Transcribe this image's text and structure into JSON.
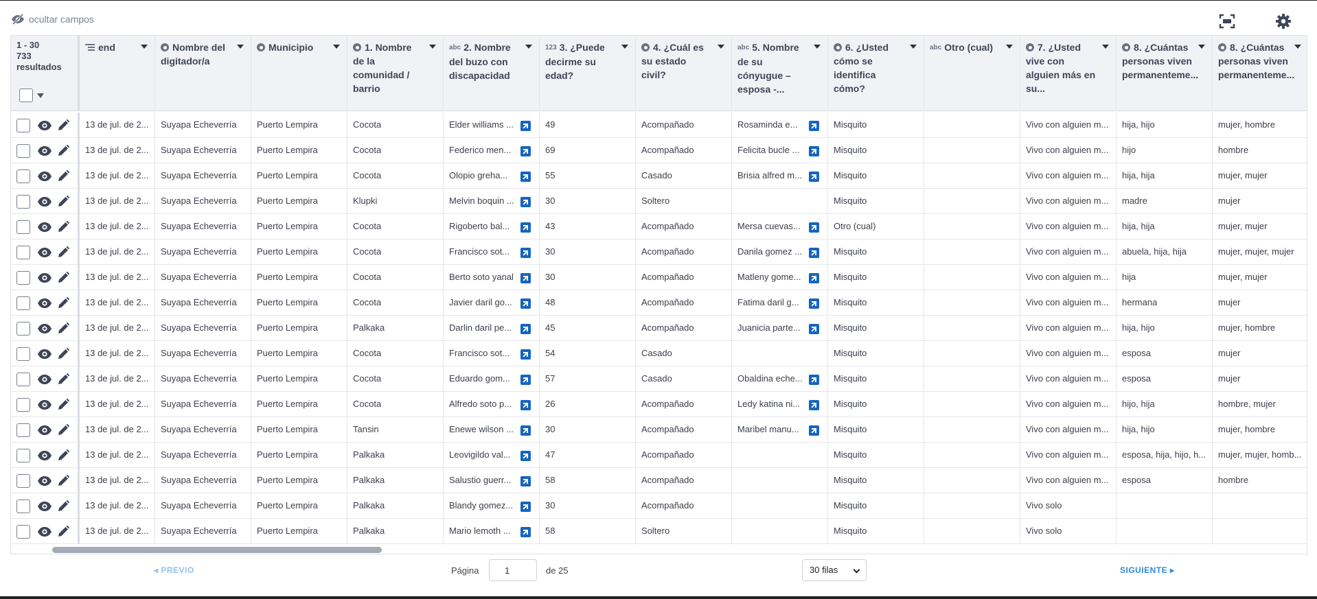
{
  "toolbar": {
    "hide_fields_label": "ocultar campos",
    "hide_fields_icon": "eye-slash-icon",
    "fullscreen_icon": "fullscreen-icon",
    "settings_icon": "gear-icon"
  },
  "summary": {
    "range": "1 - 30",
    "results": "733 resultados"
  },
  "columns": [
    {
      "type": "list",
      "label": "end"
    },
    {
      "type": "select",
      "label": "Nombre del digitador/a"
    },
    {
      "type": "select",
      "label": "Municipio"
    },
    {
      "type": "select",
      "label": "1. Nombre de la comunidad / barrio"
    },
    {
      "type": "abc",
      "label": "2. Nombre del buzo con discapacidad"
    },
    {
      "type": "123",
      "label": "3. ¿Puede decirme su edad?"
    },
    {
      "type": "select",
      "label": "4. ¿Cuál es su estado civil?"
    },
    {
      "type": "abc",
      "label": "5. Nombre de su cónyugue – esposa -..."
    },
    {
      "type": "select",
      "label": "6. ¿Usted cómo se identifica cómo?"
    },
    {
      "type": "abc",
      "label": "Otro (cual)"
    },
    {
      "type": "select",
      "label": "7. ¿Usted vive con alguien más en su..."
    },
    {
      "type": "select",
      "label": "8. ¿Cuántas personas viven permanenteme..."
    },
    {
      "type": "select",
      "label": "8. ¿Cuántas personas viven permanenteme..."
    }
  ],
  "rows": [
    [
      "13 de jul. de 2...",
      "Suyapa Echeverría",
      "Puerto Lempira",
      "Cocota",
      "Elder williams ...",
      "49",
      "Acompañado",
      "Rosaminda e...",
      "Misquito",
      "",
      "Vivo con alguien m...",
      "hija, hijo",
      "mujer, hombre"
    ],
    [
      "13 de jul. de 2...",
      "Suyapa Echeverría",
      "Puerto Lempira",
      "Cocota",
      "Federico men...",
      "69",
      "Acompañado",
      "Felicita bucle ...",
      "Misquito",
      "",
      "Vivo con alguien m...",
      "hijo",
      "hombre"
    ],
    [
      "13 de jul. de 2...",
      "Suyapa Echeverría",
      "Puerto Lempira",
      "Cocota",
      "Olopio greha...",
      "55",
      "Casado",
      "Brisia alfred m...",
      "Misquito",
      "",
      "Vivo con alguien m...",
      "hija, hija",
      "mujer, mujer"
    ],
    [
      "13 de jul. de 2...",
      "Suyapa Echeverría",
      "Puerto Lempira",
      "Klupki",
      "Melvin boquin ...",
      "30",
      "Soltero",
      "",
      "Misquito",
      "",
      "Vivo con alguien m...",
      "madre",
      "mujer"
    ],
    [
      "13 de jul. de 2...",
      "Suyapa Echeverría",
      "Puerto Lempira",
      "Cocota",
      "Rigoberto bal...",
      "43",
      "Acompañado",
      "Mersa cuevas...",
      "Otro (cual)",
      "",
      "Vivo con alguien m...",
      "hija, hija",
      "mujer, mujer"
    ],
    [
      "13 de jul. de 2...",
      "Suyapa Echeverría",
      "Puerto Lempira",
      "Cocota",
      "Francisco sot...",
      "30",
      "Acompañado",
      "Danila gomez ...",
      "Misquito",
      "",
      "Vivo con alguien m...",
      "abuela, hija, hija",
      "mujer, mujer, mujer"
    ],
    [
      "13 de jul. de 2...",
      "Suyapa Echeverría",
      "Puerto Lempira",
      "Cocota",
      "Berto soto yanal",
      "30",
      "Acompañado",
      "Matleny gome...",
      "Misquito",
      "",
      "Vivo con alguien m...",
      "hija",
      "mujer, mujer"
    ],
    [
      "13 de jul. de 2...",
      "Suyapa Echeverría",
      "Puerto Lempira",
      "Cocota",
      "Javier daril go...",
      "48",
      "Acompañado",
      "Fatima daril g...",
      "Misquito",
      "",
      "Vivo con alguien m...",
      "hermana",
      "mujer"
    ],
    [
      "13 de jul. de 2...",
      "Suyapa Echeverría",
      "Puerto Lempira",
      "Palkaka",
      "Darlin daril pe...",
      "45",
      "Acompañado",
      "Juanicia parte...",
      "Misquito",
      "",
      "Vivo con alguien m...",
      "hija, hijo",
      "mujer, hombre"
    ],
    [
      "13 de jul. de 2...",
      "Suyapa Echeverría",
      "Puerto Lempira",
      "Cocota",
      "Francisco sot...",
      "54",
      "Casado",
      "",
      "Misquito",
      "",
      "Vivo con alguien m...",
      "esposa",
      "mujer"
    ],
    [
      "13 de jul. de 2...",
      "Suyapa Echeverría",
      "Puerto Lempira",
      "Cocota",
      "Eduardo gom...",
      "57",
      "Casado",
      "Obaldina eche...",
      "Misquito",
      "",
      "Vivo con alguien m...",
      "esposa",
      "mujer"
    ],
    [
      "13 de jul. de 2...",
      "Suyapa Echeverría",
      "Puerto Lempira",
      "Cocota",
      "Alfredo soto p...",
      "26",
      "Acompañado",
      "Ledy katina ni...",
      "Misquito",
      "",
      "Vivo con alguien m...",
      "hijo, hija",
      "hombre, mujer"
    ],
    [
      "13 de jul. de 2...",
      "Suyapa Echeverría",
      "Puerto Lempira",
      "Tansin",
      "Enewe wilson ...",
      "30",
      "Acompañado",
      "Maribel manu...",
      "Misquito",
      "",
      "Vivo con alguien m...",
      "hija, hijo",
      "mujer, hombre"
    ],
    [
      "13 de jul. de 2...",
      "Suyapa Echeverría",
      "Puerto Lempira",
      "Palkaka",
      "Leovigildo val...",
      "47",
      "Acompañado",
      "",
      "Misquito",
      "",
      "Vivo con alguien m...",
      "esposa, hija, hijo, h...",
      "mujer, mujer, homb..."
    ],
    [
      "13 de jul. de 2...",
      "Suyapa Echeverría",
      "Puerto Lempira",
      "Palkaka",
      "Salustio guerr...",
      "58",
      "Acompañado",
      "",
      "Misquito",
      "",
      "Vivo con alguien m...",
      "esposa",
      "hombre"
    ],
    [
      "13 de jul. de 2...",
      "Suyapa Echeverría",
      "Puerto Lempira",
      "Palkaka",
      "Blandy gomez...",
      "30",
      "Acompañado",
      "",
      "Misquito",
      "",
      "Vivo solo",
      "",
      ""
    ],
    [
      "13 de jul. de 2...",
      "Suyapa Echeverría",
      "Puerto Lempira",
      "Palkaka",
      "Mario lemoth ...",
      "58",
      "Soltero",
      "",
      "Misquito",
      "",
      "Vivo solo",
      "",
      ""
    ]
  ],
  "pagination": {
    "prev_label": "PREVIO",
    "next_label": "SIGUIENTE",
    "page_label": "Página",
    "page_value": "1",
    "of_label": "de 25",
    "rows_per_page": "30 filas"
  }
}
